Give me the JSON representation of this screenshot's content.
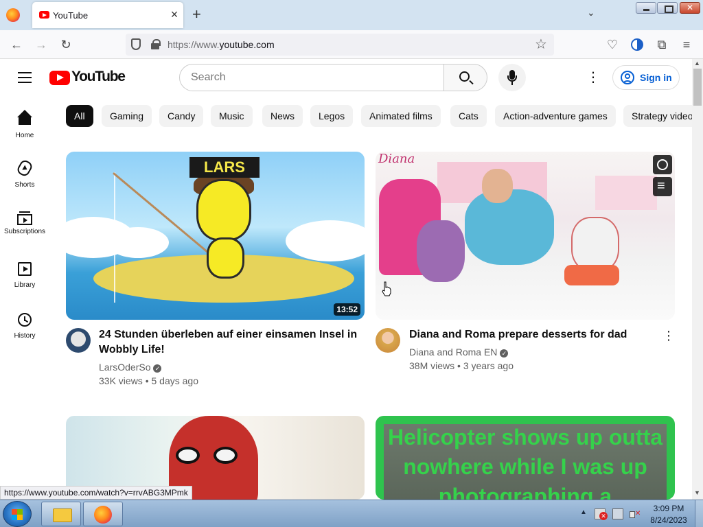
{
  "browser": {
    "tab": {
      "title": "YouTube"
    },
    "url": {
      "scheme": "https://www.",
      "host": "youtube.com"
    },
    "status_url": "https://www.youtube.com/watch?v=rrvABG3MPmk"
  },
  "youtube": {
    "logo_text": "YouTube",
    "search": {
      "placeholder": "Search"
    },
    "signin_label": "Sign in",
    "sidebar": [
      {
        "label": "Home",
        "icon": "home-icon"
      },
      {
        "label": "Shorts",
        "icon": "shorts-icon"
      },
      {
        "label": "Subscriptions",
        "icon": "subscriptions-icon"
      },
      {
        "label": "Library",
        "icon": "library-icon"
      },
      {
        "label": "History",
        "icon": "history-icon"
      }
    ],
    "chips": [
      "All",
      "Gaming",
      "Candy",
      "Music",
      "News",
      "Legos",
      "Animated films",
      "Cats",
      "Action-adventure games",
      "Strategy video games"
    ],
    "active_chip": "All",
    "videos": [
      {
        "title": "24 Stunden überleben auf einer einsamen Insel in Wobbly Life!",
        "channel": "LarsOderSo",
        "views": "33K views",
        "age": "5 days ago",
        "duration": "13:52",
        "thumb_text": "LARS"
      },
      {
        "title": "Diana and Roma prepare desserts for dad",
        "channel": "Diana and Roma EN",
        "views": "38M views",
        "age": "3 years ago",
        "thumb_text": "Diana"
      },
      {
        "title": ""
      },
      {
        "title": "",
        "thumb_text": "Helicopter shows up outta nowhere while I was up photographing a"
      }
    ]
  },
  "taskbar": {
    "time": "3:09 PM",
    "date": "8/24/2023"
  },
  "colors": {
    "yt_red": "#ff0000",
    "link_blue": "#065fd4",
    "chip_active": "#0f0f0f"
  }
}
